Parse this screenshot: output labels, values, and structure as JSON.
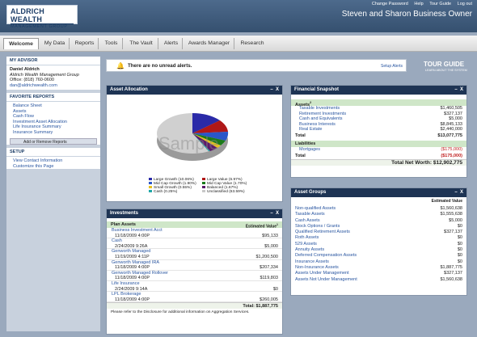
{
  "top": {
    "links": [
      "Change Password",
      "Help",
      "Tour Guide",
      "Log out"
    ],
    "greeting": "Steven and Sharon Business Owner",
    "logo1": "ALDRICH WEALTH",
    "logo2": "MANAGEMENT GROUP"
  },
  "nav": [
    "Welcome",
    "My Data",
    "Reports",
    "Tools",
    "The Vault",
    "Alerts",
    "Awards Manager",
    "Research"
  ],
  "advisor": {
    "title": "MY ADVISOR",
    "name": "Daniel Aldrich",
    "company": "Aldrich Wealth Management Group",
    "office": "Office: (818) 760-0600",
    "email": "dan@aldrichwealth.com"
  },
  "fav": {
    "title": "FAVORITE REPORTS",
    "items": [
      "Balance Sheet",
      "Assets",
      "Cash Flow",
      "Investment Asset Allocation",
      "Life Insurance Summary",
      "Insurance Summary"
    ],
    "add": "Add or Remove Reports"
  },
  "setup": {
    "title": "SETUP",
    "items": [
      "View Contact Information",
      "Customize this Page"
    ]
  },
  "alert": {
    "text": "There are no unread alerts.",
    "setup": "Setup Alerts"
  },
  "tourguide": {
    "t1": "TOUR GUIDE",
    "t2": "LEARN ABOUT THE SYSTEM"
  },
  "allocation": {
    "title": "Asset Allocation",
    "watermark": "Sample",
    "legend": [
      {
        "label": "Large Growth (10.06%)",
        "color": "#2a2aa8"
      },
      {
        "label": "Large Value (6.97%)",
        "color": "#b01818"
      },
      {
        "label": "Mid Cap Growth (1.90%)",
        "color": "#2a56c8"
      },
      {
        "label": "Mid Cap Value (1.70%)",
        "color": "#1a7a1a"
      },
      {
        "label": "Small Growth (0.55%)",
        "color": "#e6c020"
      },
      {
        "label": "Balanced (1.67%)",
        "color": "#5a1a6a"
      },
      {
        "label": "Cash (0.25%)",
        "color": "#20a8a8"
      },
      {
        "label": "Unclassified (63.59%)",
        "color": "#c8c8c8"
      }
    ]
  },
  "investments": {
    "title": "Investments",
    "col1": "Plan Assets",
    "col2": "Estimated Value",
    "items": [
      {
        "name": "Business Investment Acct",
        "date": "11/18/2009 4:00P",
        "value": "$95,133"
      },
      {
        "name": "Cash",
        "date": "2/24/2009 9:26A",
        "value": "$5,000"
      },
      {
        "name": "Genworth Managed",
        "date": "11/19/2009 4:11P",
        "value": "$1,200,500"
      },
      {
        "name": "Genworth Managed IRA",
        "date": "11/18/2009 4:00P",
        "value": "$207,334"
      },
      {
        "name": "Genworth Managed Rollover",
        "date": "11/18/2009 4:00P",
        "value": "$119,803"
      },
      {
        "name": "Life Insurance",
        "date": "2/24/2009 9:14A",
        "value": "$0"
      },
      {
        "name": "LPL Brokerage",
        "date": "11/18/2009 4:00P",
        "value": "$260,005"
      }
    ],
    "total": "Total: $1,887,775",
    "note": "Please refer to the Disclosure for additional information on Aggregation Services."
  },
  "snapshot": {
    "title": "Financial Snapshot",
    "assets_label": "Assets",
    "assets": [
      {
        "name": "Taxable Investments",
        "value": "$1,460,505"
      },
      {
        "name": "Retirement Investments",
        "value": "$327,137"
      },
      {
        "name": "Cash and Equivalents",
        "value": "$5,000"
      },
      {
        "name": "Business Interests",
        "value": "$8,845,133"
      },
      {
        "name": "Real Estate",
        "value": "$2,440,000"
      }
    ],
    "assets_total_label": "Total",
    "assets_total": "$13,077,775",
    "liab_label": "Liabilities",
    "liab": [
      {
        "name": "Mortgages",
        "value": "($175,000)"
      }
    ],
    "liab_total_label": "Total",
    "liab_total": "($175,000)",
    "networth": "Total Net Worth: $12,902,775"
  },
  "groups": {
    "title": "Asset Groups",
    "col": "Estimated Value",
    "items": [
      {
        "name": "Non-qualified Assets",
        "value": "$1,560,638"
      },
      {
        "name": "Taxable Assets",
        "value": "$1,555,638"
      },
      {
        "name": "Cash Assets",
        "value": "$5,000"
      },
      {
        "name": "Stock Options / Grants",
        "value": "$0"
      },
      {
        "name": "Qualified Retirement Assets",
        "value": "$327,137"
      },
      {
        "name": "Roth Assets",
        "value": "$0"
      },
      {
        "name": "529 Assets",
        "value": "$0"
      },
      {
        "name": "Annuity Assets",
        "value": "$0"
      },
      {
        "name": "Deferred Compensation Assets",
        "value": "$0"
      },
      {
        "name": "Insurance Assets",
        "value": "$0"
      },
      {
        "name": "Non-Insurance Assets",
        "value": "$1,887,775"
      },
      {
        "name": "Assets Under Management",
        "value": "$327,137"
      },
      {
        "name": "Assets Not Under Management",
        "value": "$1,560,638"
      }
    ]
  }
}
